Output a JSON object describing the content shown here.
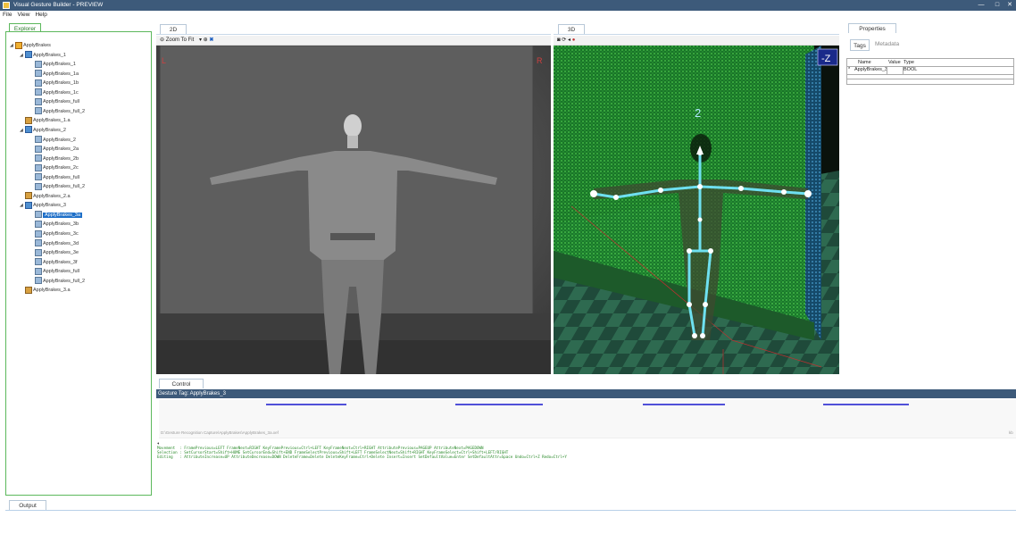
{
  "window": {
    "title": "Visual Gesture Builder - PREVIEW",
    "min": "—",
    "max": "□",
    "close": "✕"
  },
  "menu": [
    "File",
    "View",
    "Help"
  ],
  "explorer": {
    "tab": "Explorer",
    "tree": [
      {
        "label": "ApplyBrakes",
        "level": 0,
        "icon": "proj",
        "expander": "◢"
      },
      {
        "label": "ApplyBrakes_1",
        "level": 1,
        "icon": "folder",
        "expander": "◢"
      },
      {
        "label": "ApplyBrakes_1",
        "level": 2,
        "icon": "clip"
      },
      {
        "label": "ApplyBrakes_1a",
        "level": 2,
        "icon": "clip"
      },
      {
        "label": "ApplyBrakes_1b",
        "level": 2,
        "icon": "clip"
      },
      {
        "label": "ApplyBrakes_1c",
        "level": 2,
        "icon": "clip"
      },
      {
        "label": "ApplyBrakes_full",
        "level": 2,
        "icon": "clip"
      },
      {
        "label": "ApplyBrakes_full_2",
        "level": 2,
        "icon": "clip"
      },
      {
        "label": "ApplyBrakes_1.a",
        "level": 1,
        "icon": "file"
      },
      {
        "label": "ApplyBrakes_2",
        "level": 1,
        "icon": "folder",
        "expander": "◢"
      },
      {
        "label": "ApplyBrakes_2",
        "level": 2,
        "icon": "clip"
      },
      {
        "label": "ApplyBrakes_2a",
        "level": 2,
        "icon": "clip"
      },
      {
        "label": "ApplyBrakes_2b",
        "level": 2,
        "icon": "clip"
      },
      {
        "label": "ApplyBrakes_2c",
        "level": 2,
        "icon": "clip"
      },
      {
        "label": "ApplyBrakes_full",
        "level": 2,
        "icon": "clip"
      },
      {
        "label": "ApplyBrakes_full_2",
        "level": 2,
        "icon": "clip"
      },
      {
        "label": "ApplyBrakes_2.a",
        "level": 1,
        "icon": "file"
      },
      {
        "label": "ApplyBrakes_3",
        "level": 1,
        "icon": "folder",
        "expander": "◢"
      },
      {
        "label": "ApplyBrakes_3a",
        "level": 2,
        "icon": "clip",
        "selected": true
      },
      {
        "label": "ApplyBrakes_3b",
        "level": 2,
        "icon": "clip"
      },
      {
        "label": "ApplyBrakes_3c",
        "level": 2,
        "icon": "clip"
      },
      {
        "label": "ApplyBrakes_3d",
        "level": 2,
        "icon": "clip"
      },
      {
        "label": "ApplyBrakes_3e",
        "level": 2,
        "icon": "clip"
      },
      {
        "label": "ApplyBrakes_3f",
        "level": 2,
        "icon": "clip"
      },
      {
        "label": "ApplyBrakes_full",
        "level": 2,
        "icon": "clip"
      },
      {
        "label": "ApplyBrakes_full_2",
        "level": 2,
        "icon": "clip"
      },
      {
        "label": "ApplyBrakes_3.a",
        "level": 1,
        "icon": "file"
      }
    ]
  },
  "view2d": {
    "tab": "2D",
    "zoom_label": "Zoom To Fit",
    "corner_left": "L",
    "corner_right": "R"
  },
  "view3d": {
    "tab": "3D",
    "axis_label": "-Z",
    "body_index": "2"
  },
  "properties": {
    "tab": "Properties",
    "subtabs": [
      "Tags",
      "Metadata"
    ],
    "columns": [
      "Name",
      "Value",
      "Type"
    ],
    "rows": [
      {
        "marker": "*",
        "name": "ApplyBrakes_3",
        "value": "",
        "type": "BOOL"
      }
    ]
  },
  "control": {
    "tab": "Control",
    "gesture_tag": "Gesture Tag: ApplyBrakes_3",
    "path": "D:\\Gesture Recognition Capture\\ApplyBrakes\\ApplyBrakes_3a.xef",
    "marker": "♦",
    "right_indicator": "kb",
    "hints": [
      "Movement  : FramePrevious=LEFT FrameNext=RIGHT KeyFramePrevious=Ctrl+LEFT KeyFrameNext=Ctrl+RIGHT AttributePrevious=PAGEUP AttributeNext=PAGEDOWN",
      "Selection : SetCursorStart=Shift+HOME SetCursorEnd=Shift+END FrameSelectPrevious=Shift+LEFT FrameSelectNext=Shift+RIGHT KeyFrameSelect=Ctrl+Shift+LEFT/RIGHT",
      "Editing   : AttributeIncrease=UP AttributeDecrease=DOWN DeleteFrame=Delete DeleteKeyFrame=Ctrl+Delete Insert=Insert SetDefaultValue=Enter SetDefaultAttr=Space Undo=Ctrl+Z Redo=Ctrl+Y"
    ]
  },
  "output": {
    "tab": "Output"
  },
  "colors": {
    "accent": "#5cb85c",
    "titlebar": "#3d5a7a",
    "selection": "#1e6fc8",
    "skeleton": "#6ee0f0",
    "timeline_segment": "#5050d8"
  }
}
